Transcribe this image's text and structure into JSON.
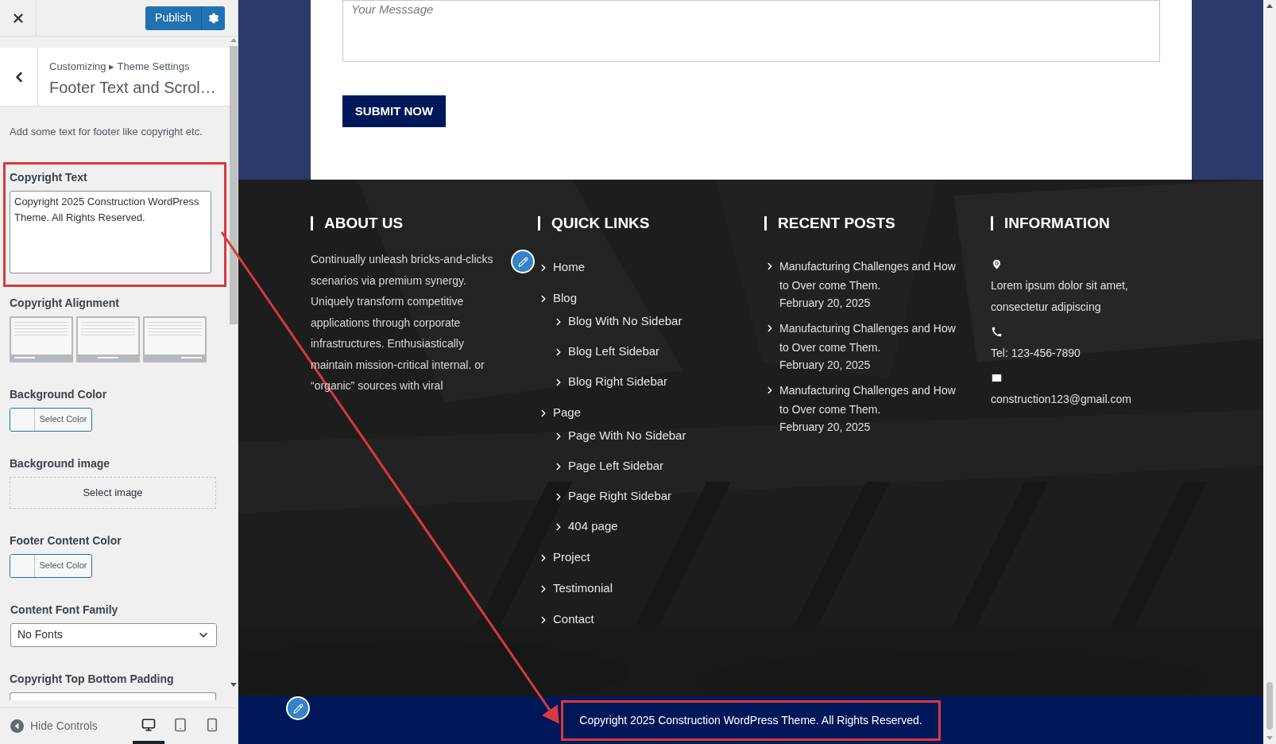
{
  "customizer": {
    "publish": "Publish",
    "breadcrumb": "Customizing ▸ Theme Settings",
    "section_title": "Footer Text and Scrol…",
    "description": "Add some text for footer like copyright etc.",
    "controls": [
      {
        "kind": "textarea",
        "label": "Copyright Text",
        "value": "Copyright 2025 Construction WordPress Theme. All Rights Reserved.",
        "highlighted": true
      },
      {
        "kind": "alignment",
        "label": "Copyright Alignment",
        "options": [
          {
            "kind": "left"
          },
          {
            "kind": "center"
          },
          {
            "kind": "right"
          }
        ]
      },
      {
        "kind": "color",
        "label": "Background Color",
        "button": "Select Color"
      },
      {
        "label": "Background image",
        "button": "Select image"
      },
      {
        "kind": "color",
        "label": "Footer Content Color",
        "button": "Select Color"
      },
      {
        "kind": "select",
        "label": "Content Font Family",
        "value": "No Fonts"
      },
      {
        "kind": "partial",
        "label": "Copyright Top Bottom Padding"
      }
    ],
    "hide_controls": "Hide Controls",
    "devices": [
      {
        "kind": "desktop",
        "selected": true
      },
      {
        "kind": "tablet",
        "selected": false
      },
      {
        "kind": "mobile",
        "selected": false
      }
    ]
  },
  "preview": {
    "message_placeholder": "Your Messsage",
    "submit": "SUBMIT NOW",
    "about": {
      "heading": "ABOUT US",
      "text": "Continually unleash bricks-and-clicks scenarios via premium synergy. Uniquely transform competitive applications through corporate infrastructures. Enthusiastically maintain mission-critical internal. or “organic” sources with viral"
    },
    "quick_links": {
      "heading": "QUICK LINKS",
      "links": [
        {
          "label": "Home"
        },
        {
          "label": "Blog",
          "children": [
            {
              "label": "Blog With No Sidebar"
            },
            {
              "label": "Blog Left Sidebar"
            },
            {
              "label": "Blog Right Sidebar"
            }
          ]
        },
        {
          "label": "Page",
          "children": [
            {
              "label": "Page With No Sidebar"
            },
            {
              "label": "Page Left Sidebar"
            },
            {
              "label": "Page Right Sidebar"
            },
            {
              "label": "404 page"
            }
          ]
        },
        {
          "label": "Project"
        },
        {
          "label": "Testimonial"
        },
        {
          "label": "Contact"
        }
      ]
    },
    "recent_posts": {
      "heading": "RECENT POSTS",
      "posts": [
        {
          "title": "Manufacturing Challenges and How to Over come Them.",
          "date": "February 20, 2025"
        },
        {
          "title": "Manufacturing Challenges and How to Over come Them.",
          "date": "February 20, 2025"
        },
        {
          "title": "Manufacturing Challenges and How to Over come Them.",
          "date": "February 20, 2025"
        }
      ]
    },
    "information": {
      "heading": "INFORMATION",
      "items": [
        {
          "kind": "location",
          "text": "Lorem ipsum dolor sit amet, consectetur adipiscing"
        },
        {
          "kind": "phone",
          "text": "Tel: 123-456-7890"
        },
        {
          "kind": "email",
          "text": "construction123@gmail.com"
        }
      ]
    },
    "copyright": {
      "text": "Copyright 2025 Construction WordPress Theme. All Rights Reserved.",
      "highlighted": true
    }
  }
}
